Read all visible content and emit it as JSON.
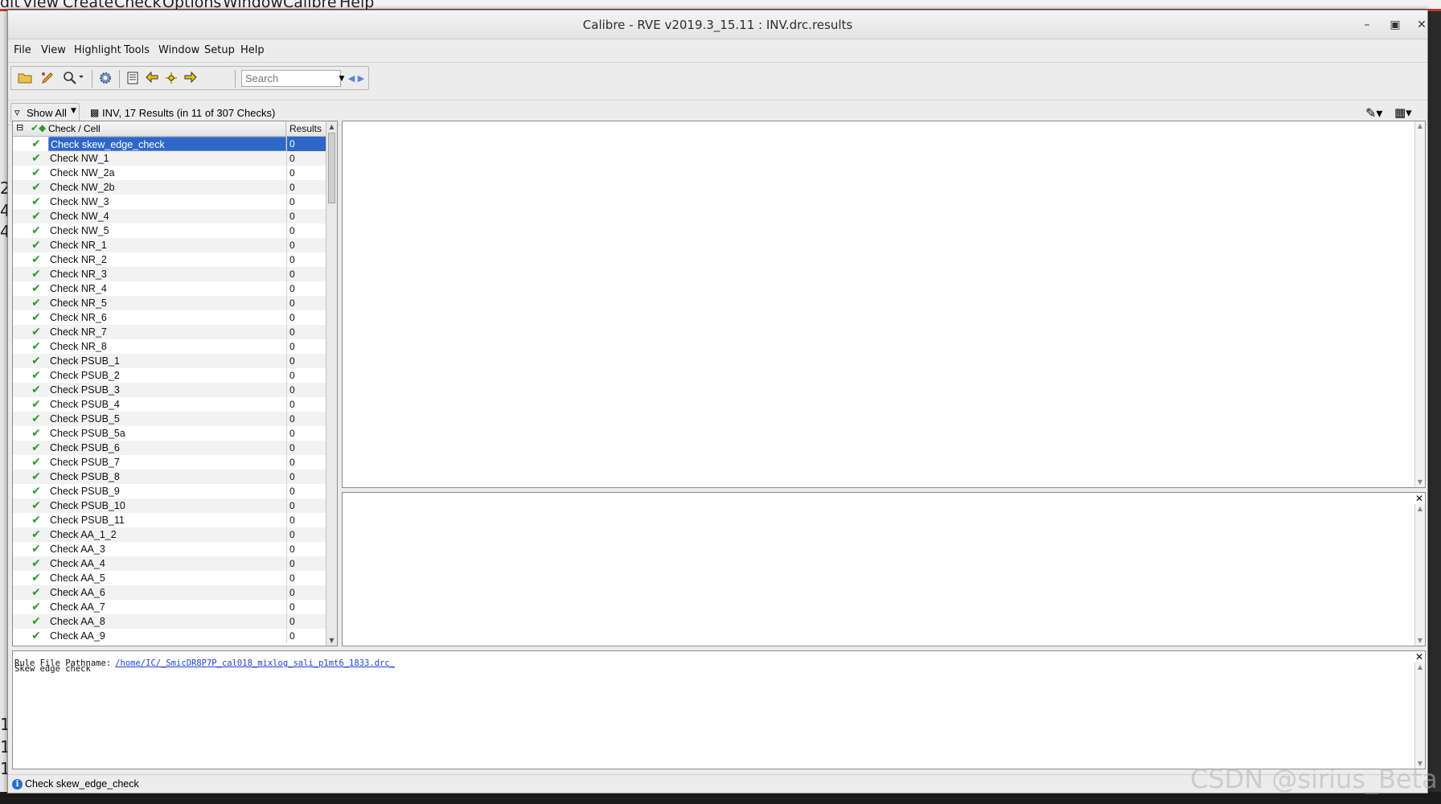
{
  "background_menu": [
    "dit",
    "View",
    "Create",
    "Check",
    "Options",
    "Window",
    "Calibre",
    "Help"
  ],
  "background_left_chars": [
    "2",
    "4",
    "4",
    "1",
    "1",
    "1"
  ],
  "window": {
    "title": "Calibre - RVE v2019.3_15.11 : INV.drc.results"
  },
  "menu": [
    "File",
    "View",
    "Highlight",
    "Tools",
    "Window",
    "Setup",
    "Help"
  ],
  "toolbar": {
    "search_placeholder": "Search",
    "icons": [
      "open-folder-icon",
      "highlight-pen-icon",
      "zoom-icon",
      "settings-gear-icon",
      "filter-list-icon",
      "back-arrow-icon",
      "center-icon",
      "forward-arrow-icon"
    ]
  },
  "filter": {
    "show_all_label": "Show All",
    "summary": "INV, 17 Results (in 11 of 307 Checks)"
  },
  "tree": {
    "col_check": "Check / Cell",
    "col_results": "Results",
    "rows": [
      {
        "label": "Check skew_edge_check",
        "value": "0"
      },
      {
        "label": "Check NW_1",
        "value": "0"
      },
      {
        "label": "Check NW_2a",
        "value": "0"
      },
      {
        "label": "Check NW_2b",
        "value": "0"
      },
      {
        "label": "Check NW_3",
        "value": "0"
      },
      {
        "label": "Check NW_4",
        "value": "0"
      },
      {
        "label": "Check NW_5",
        "value": "0"
      },
      {
        "label": "Check NR_1",
        "value": "0"
      },
      {
        "label": "Check NR_2",
        "value": "0"
      },
      {
        "label": "Check NR_3",
        "value": "0"
      },
      {
        "label": "Check NR_4",
        "value": "0"
      },
      {
        "label": "Check NR_5",
        "value": "0"
      },
      {
        "label": "Check NR_6",
        "value": "0"
      },
      {
        "label": "Check NR_7",
        "value": "0"
      },
      {
        "label": "Check NR_8",
        "value": "0"
      },
      {
        "label": "Check PSUB_1",
        "value": "0"
      },
      {
        "label": "Check PSUB_2",
        "value": "0"
      },
      {
        "label": "Check PSUB_3",
        "value": "0"
      },
      {
        "label": "Check PSUB_4",
        "value": "0"
      },
      {
        "label": "Check PSUB_5",
        "value": "0"
      },
      {
        "label": "Check PSUB_5a",
        "value": "0"
      },
      {
        "label": "Check PSUB_6",
        "value": "0"
      },
      {
        "label": "Check PSUB_7",
        "value": "0"
      },
      {
        "label": "Check PSUB_8",
        "value": "0"
      },
      {
        "label": "Check PSUB_9",
        "value": "0"
      },
      {
        "label": "Check PSUB_10",
        "value": "0"
      },
      {
        "label": "Check PSUB_11",
        "value": "0"
      },
      {
        "label": "Check AA_1_2",
        "value": "0"
      },
      {
        "label": "Check AA_3",
        "value": "0"
      },
      {
        "label": "Check AA_4",
        "value": "0"
      },
      {
        "label": "Check AA_5",
        "value": "0"
      },
      {
        "label": "Check AA_6",
        "value": "0"
      },
      {
        "label": "Check AA_7",
        "value": "0"
      },
      {
        "label": "Check AA_8",
        "value": "0"
      },
      {
        "label": "Check AA_9",
        "value": "0"
      }
    ]
  },
  "rule_info": {
    "label": "Rule File Pathname:",
    "path": "/home/IC/_SmicDR8P7P_cal018_mixlog_sali_p1mt6_1833.drc_",
    "description": "Skew edge check"
  },
  "status": {
    "text": "Check skew_edge_check"
  },
  "watermark": "CSDN @sirius_Beta",
  "colors": {
    "selection": "#2f67c6",
    "check_ok": "#2e9a2e",
    "link": "#1f3fd6"
  }
}
